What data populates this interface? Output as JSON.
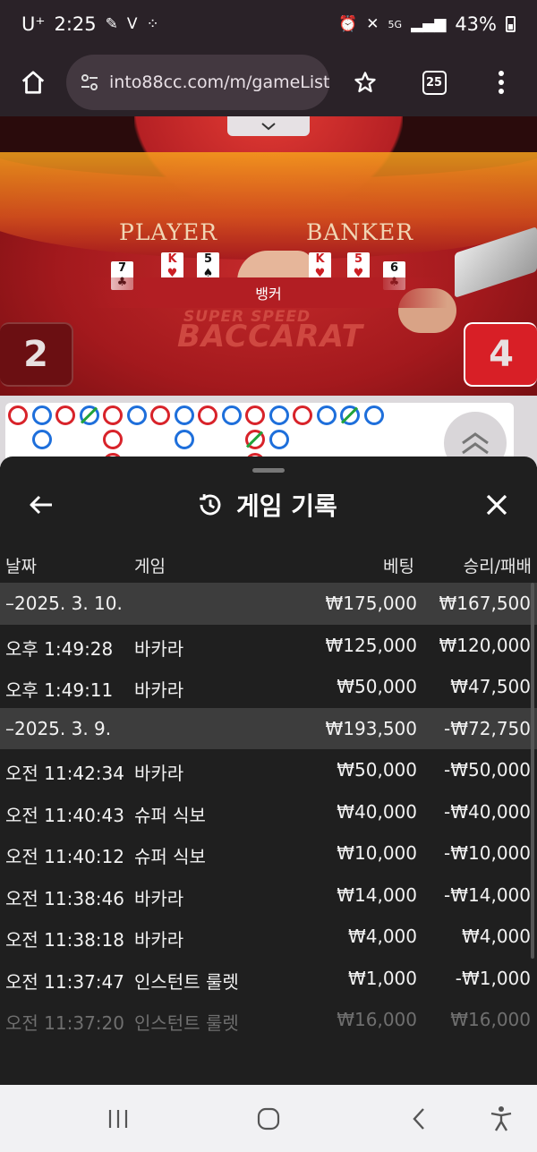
{
  "status_bar": {
    "carrier": "U⁺",
    "time": "2:25",
    "battery": "43%"
  },
  "browser": {
    "url": "into88cc.com/m/gameList",
    "tab_count": "25"
  },
  "game": {
    "player_label": "PLAYER",
    "banker_label": "BANKER",
    "player_cards": [
      "7",
      "K",
      "5"
    ],
    "banker_cards": [
      "K",
      "5",
      "6"
    ],
    "result_text": "뱅커",
    "brand_line1": "SUPER SPEED",
    "brand_line2": "BACCARAT",
    "player_score": "2",
    "banker_score": "4"
  },
  "history": {
    "title": "게임 기록",
    "columns": {
      "date": "날짜",
      "game": "게임",
      "bet": "베팅",
      "winloss": "승리/패배"
    },
    "rows": [
      {
        "type": "date",
        "col1": "–2025. 3. 10.",
        "col2": "",
        "bet": "₩175,000",
        "winloss": "₩167,500"
      },
      {
        "type": "item",
        "col1": "오후 1:49:28",
        "col2": "바카라",
        "bet": "₩125,000",
        "winloss": "₩120,000"
      },
      {
        "type": "item",
        "col1": "오후 1:49:11",
        "col2": "바카라",
        "bet": "₩50,000",
        "winloss": "₩47,500"
      },
      {
        "type": "date",
        "col1": "–2025. 3. 9.",
        "col2": "",
        "bet": "₩193,500",
        "winloss": "-₩72,750"
      },
      {
        "type": "item",
        "col1": "오전 11:42:34",
        "col2": "바카라",
        "bet": "₩50,000",
        "winloss": "-₩50,000"
      },
      {
        "type": "item",
        "col1": "오전 11:40:43",
        "col2": "슈퍼 식보",
        "bet": "₩40,000",
        "winloss": "-₩40,000"
      },
      {
        "type": "item",
        "col1": "오전 11:40:12",
        "col2": "슈퍼 식보",
        "bet": "₩10,000",
        "winloss": "-₩10,000"
      },
      {
        "type": "item",
        "col1": "오전 11:38:46",
        "col2": "바카라",
        "bet": "₩14,000",
        "winloss": "-₩14,000"
      },
      {
        "type": "item",
        "col1": "오전 11:38:18",
        "col2": "바카라",
        "bet": "₩4,000",
        "winloss": "₩4,000"
      },
      {
        "type": "item",
        "col1": "오전 11:37:47",
        "col2": "인스턴트 룰렛",
        "bet": "₩1,000",
        "winloss": "-₩1,000"
      },
      {
        "type": "item fade",
        "col1": "오전 11:37:20",
        "col2": "인스턴트 룰렛",
        "bet": "₩16,000",
        "winloss": "₩16,000"
      }
    ]
  },
  "road": {
    "row1": [
      "r",
      "b",
      "r",
      "tb",
      "r",
      "b",
      "r",
      "b",
      "r",
      "b",
      "r",
      "b",
      "r",
      "b",
      "tb",
      "b"
    ],
    "row2": [
      "",
      "b",
      "",
      "",
      "r",
      "",
      "",
      "b",
      "",
      "",
      "tr",
      "b"
    ],
    "row3": [
      "",
      "",
      "",
      "",
      "r",
      "",
      "",
      "",
      "",
      "",
      "r",
      ""
    ]
  },
  "icons": {
    "home": "home-icon",
    "site_settings": "tune-icon",
    "bookmark": "star-icon",
    "tabs": "tabs-icon",
    "menu": "more-vert-icon",
    "back": "arrow-left-icon",
    "history": "history-icon",
    "close": "close-icon",
    "expand": "chevron-double-up-icon"
  }
}
